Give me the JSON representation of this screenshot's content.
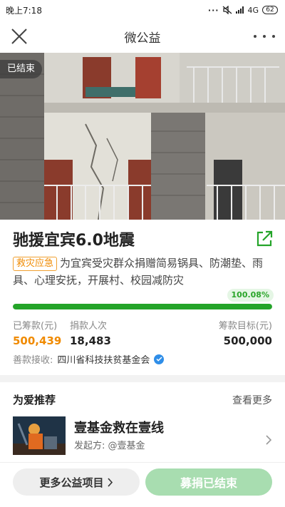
{
  "status_bar": {
    "time": "晚上7:18",
    "network": "4G",
    "battery": "62"
  },
  "nav": {
    "title": "微公益"
  },
  "hero": {
    "badge": "已结束"
  },
  "project": {
    "title": "驰援宜宾6.0地震",
    "tag": "救灾应急",
    "description": "为宜宾受灾群众捐赠简易锅具、防潮垫、雨具、心理安抚，开展村、校园减防灾",
    "progress_label": "100.08%",
    "progress_fraction": 1.0
  },
  "stats": {
    "raised_label": "已筹款(元)",
    "raised_value": "500,439",
    "donors_label": "捐款人次",
    "donors_value": "18,483",
    "goal_label": "筹款目标(元)",
    "goal_value": "500,000"
  },
  "recipient": {
    "label": "善款接收:",
    "org": "四川省科技扶贫基金会"
  },
  "recommend": {
    "title": "为爱推荐",
    "more": "查看更多",
    "item": {
      "name": "壹基金救在壹线",
      "sponsor": "发起方: @壹基金"
    }
  },
  "bottom": {
    "more_button": "更多公益项目",
    "donate_button": "募捐已结束"
  },
  "colors": {
    "accent_green": "#24a429",
    "orange": "#f08a00",
    "donate_disabled": "#a8ddb0"
  }
}
